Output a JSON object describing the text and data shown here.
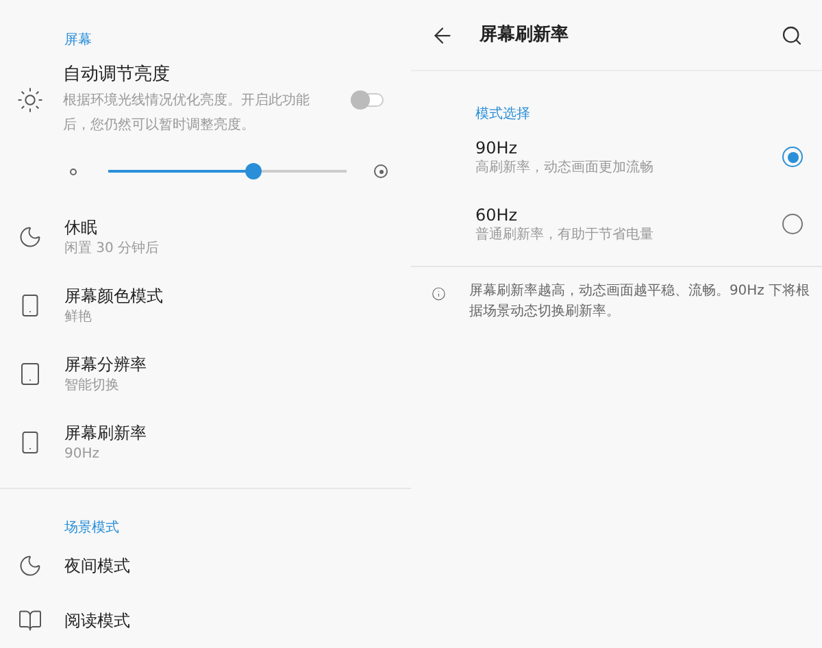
{
  "left": {
    "section": "屏幕",
    "auto_brightness": {
      "title": "自动调节亮度",
      "description": "根据环境光线情况优化亮度。开启此功能后，您仍然可以暂时调整亮度。",
      "on": false
    },
    "brightness": {
      "level": 0.61
    },
    "items": [
      {
        "kind": "sleep",
        "title": "休眠",
        "subtitle": "闲置 30 分钟后"
      },
      {
        "kind": "color",
        "title": "屏幕颜色模式",
        "subtitle": "鲜艳"
      },
      {
        "kind": "resolution",
        "title": "屏幕分辨率",
        "subtitle": "智能切换"
      },
      {
        "kind": "refresh",
        "title": "屏幕刷新率",
        "subtitle": "90Hz"
      }
    ],
    "scene_section": "场景模式",
    "scene_items": [
      {
        "kind": "night",
        "title": "夜间模式"
      },
      {
        "kind": "reading",
        "title": "阅读模式"
      }
    ]
  },
  "right": {
    "title": "屏幕刷新率",
    "section": "模式选择",
    "options": [
      {
        "title": "90Hz",
        "subtitle": "高刷新率，动态画面更加流畅",
        "selected": true
      },
      {
        "title": "60Hz",
        "subtitle": "普通刷新率，有助于节省电量",
        "selected": false
      }
    ],
    "info": "屏幕刷新率越高，动态画面越平稳、流畅。90Hz 下将根据场景动态切换刷新率。"
  }
}
